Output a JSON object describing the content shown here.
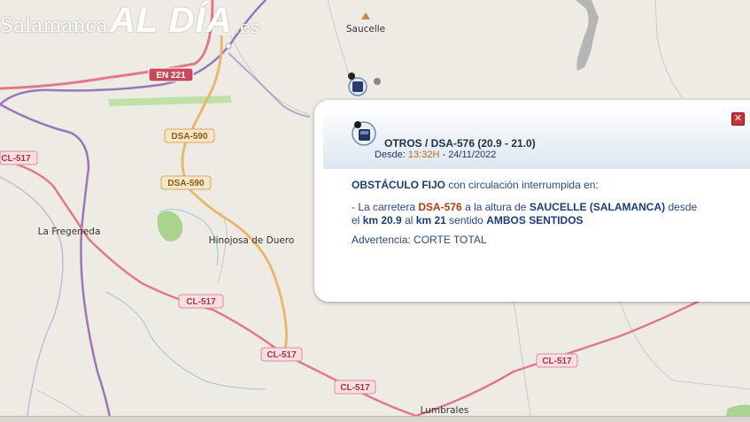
{
  "brand": {
    "word1": "Salamanca",
    "word2": "AL DÍA",
    "word3": ".es"
  },
  "map": {
    "places": {
      "saucelle": "Saucelle",
      "la_fregeneda": "La Fregeneda",
      "hinojosa": "Hinojosa de Duero",
      "lumbrales": "Lumbrales"
    },
    "shields": {
      "en221": "EN 221",
      "dsa590_a": "DSA-590",
      "dsa590_b": "DSA-590",
      "cl517_a": "CL-517",
      "cl517_b": "CL-517",
      "cl517_c": "CL-517",
      "cl517_d": "CL-517",
      "cl517_e": "CL-517"
    }
  },
  "popup": {
    "close_symbol": "✕",
    "title": "OTROS / DSA-576 (20.9 - 21.0)",
    "since_label": "Desde:",
    "since_time": "13:32H",
    "since_date": "- 24/11/2022",
    "line1_bold": "OBSTÁCULO FIJO",
    "line1_rest": "con circulación interrumpida en:",
    "line2_a": "- La carretera",
    "line2_road": "DSA-576",
    "line2_b": "a la altura de",
    "line2_place": "SAUCELLE (SALAMANCA)",
    "line2_c": "desde el",
    "line2_km1": "km 20.9",
    "line2_d": "al",
    "line2_km2": "km 21",
    "line2_e": "sentido",
    "line2_dir": "AMBOS SENTIDOS",
    "line3_label": "Advertencia:",
    "line3_value": "CORTE TOTAL"
  },
  "colors": {
    "background": "#eeebe4",
    "border_purple": "#9a78b8",
    "road_red": "#d05a6a",
    "road_orange": "#e8b870",
    "road_gray": "#b8a8c8",
    "green_area": "#a9d48f",
    "popup_title": "#1f2f45",
    "popup_text": "#284a86",
    "popup_highlight": "#b33a1a"
  },
  "icons": [
    "roadwork-marker-icon",
    "close-icon",
    "peak-icon"
  ]
}
